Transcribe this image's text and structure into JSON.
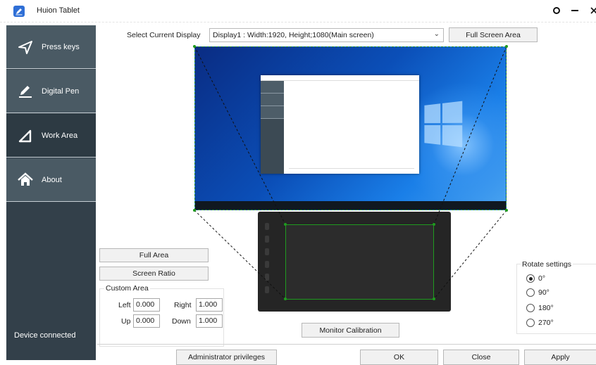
{
  "window": {
    "title": "Huion Tablet",
    "controls": [
      "settings",
      "minimize",
      "close"
    ]
  },
  "sidebar": {
    "items": [
      {
        "label": "Press keys",
        "icon": "send-arrow-icon"
      },
      {
        "label": "Digital Pen",
        "icon": "pen-icon"
      },
      {
        "label": "Work Area",
        "icon": "triangle-icon",
        "active": true
      },
      {
        "label": "About",
        "icon": "home-icon"
      }
    ],
    "status": "Device connected"
  },
  "display": {
    "label": "Select Current Display",
    "selected": "Display1 : Width:1920, Height;1080(Main screen)",
    "full_screen_button": "Full Screen Area"
  },
  "area_buttons": {
    "full_area": "Full Area",
    "screen_ratio": "Screen Ratio"
  },
  "custom_area": {
    "legend": "Custom Area",
    "left_label": "Left",
    "left_value": "0.000",
    "right_label": "Right",
    "right_value": "1.000",
    "up_label": "Up",
    "up_value": "0.000",
    "down_label": "Down",
    "down_value": "1.000"
  },
  "monitor_calibration": "Monitor Calibration",
  "rotate": {
    "legend": "Rotate settings",
    "options": [
      "0°",
      "90°",
      "180°",
      "270°"
    ],
    "selected": "0°"
  },
  "footer": {
    "admin": "Administrator privileges",
    "ok": "OK",
    "close": "Close",
    "apply": "Apply"
  },
  "colors": {
    "sidebar_bg": "#33404a",
    "nav_item_bg": "#4a5a64",
    "area_outline": "#1f9a1f"
  }
}
